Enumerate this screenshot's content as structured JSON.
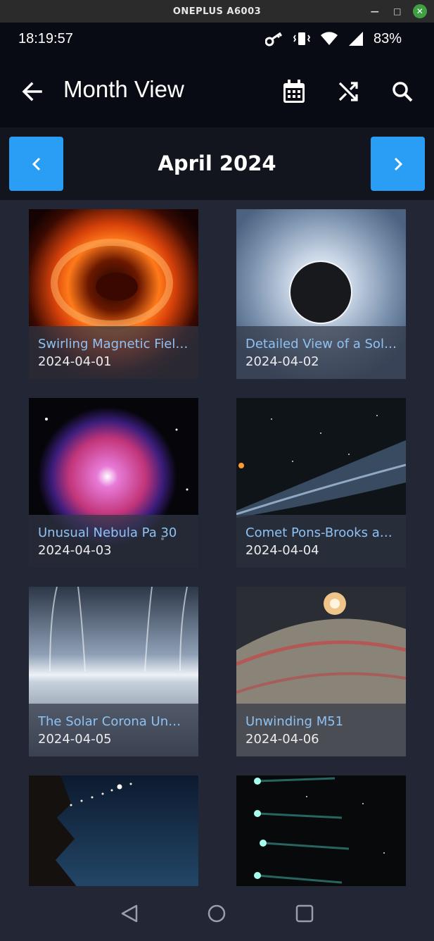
{
  "window": {
    "title": "ONEPLUS A6003"
  },
  "status": {
    "time": "18:19:57",
    "battery": "83%"
  },
  "app_bar": {
    "title": "Month View",
    "icons": [
      "back-arrow-icon",
      "calendar-icon",
      "shuffle-icon",
      "search-icon"
    ]
  },
  "month_nav": {
    "title": "April 2024",
    "prev_icon": "chevron-left-icon",
    "next_icon": "chevron-right-icon"
  },
  "cards": [
    {
      "title": "Swirling Magnetic Field ...",
      "date": "2024-04-01"
    },
    {
      "title": "Detailed View of a Solar ...",
      "date": "2024-04-02"
    },
    {
      "title": "Unusual Nebula Pa 30",
      "date": "2024-04-03"
    },
    {
      "title": "Comet Pons-Brooks at Ni...",
      "date": "2024-04-04"
    },
    {
      "title": "The Solar Corona Unwra...",
      "date": "2024-04-05"
    },
    {
      "title": "Unwinding M51",
      "date": "2024-04-06"
    },
    {
      "title": "",
      "date": ""
    },
    {
      "title": "",
      "date": ""
    }
  ],
  "colors": {
    "accent": "#2a9df4",
    "caption_title": "#8fc2f2",
    "background": "#232634",
    "app_bar": "#090b14"
  },
  "system_nav": {
    "icons": [
      "back-triangle-icon",
      "home-circle-icon",
      "recents-square-icon"
    ]
  }
}
